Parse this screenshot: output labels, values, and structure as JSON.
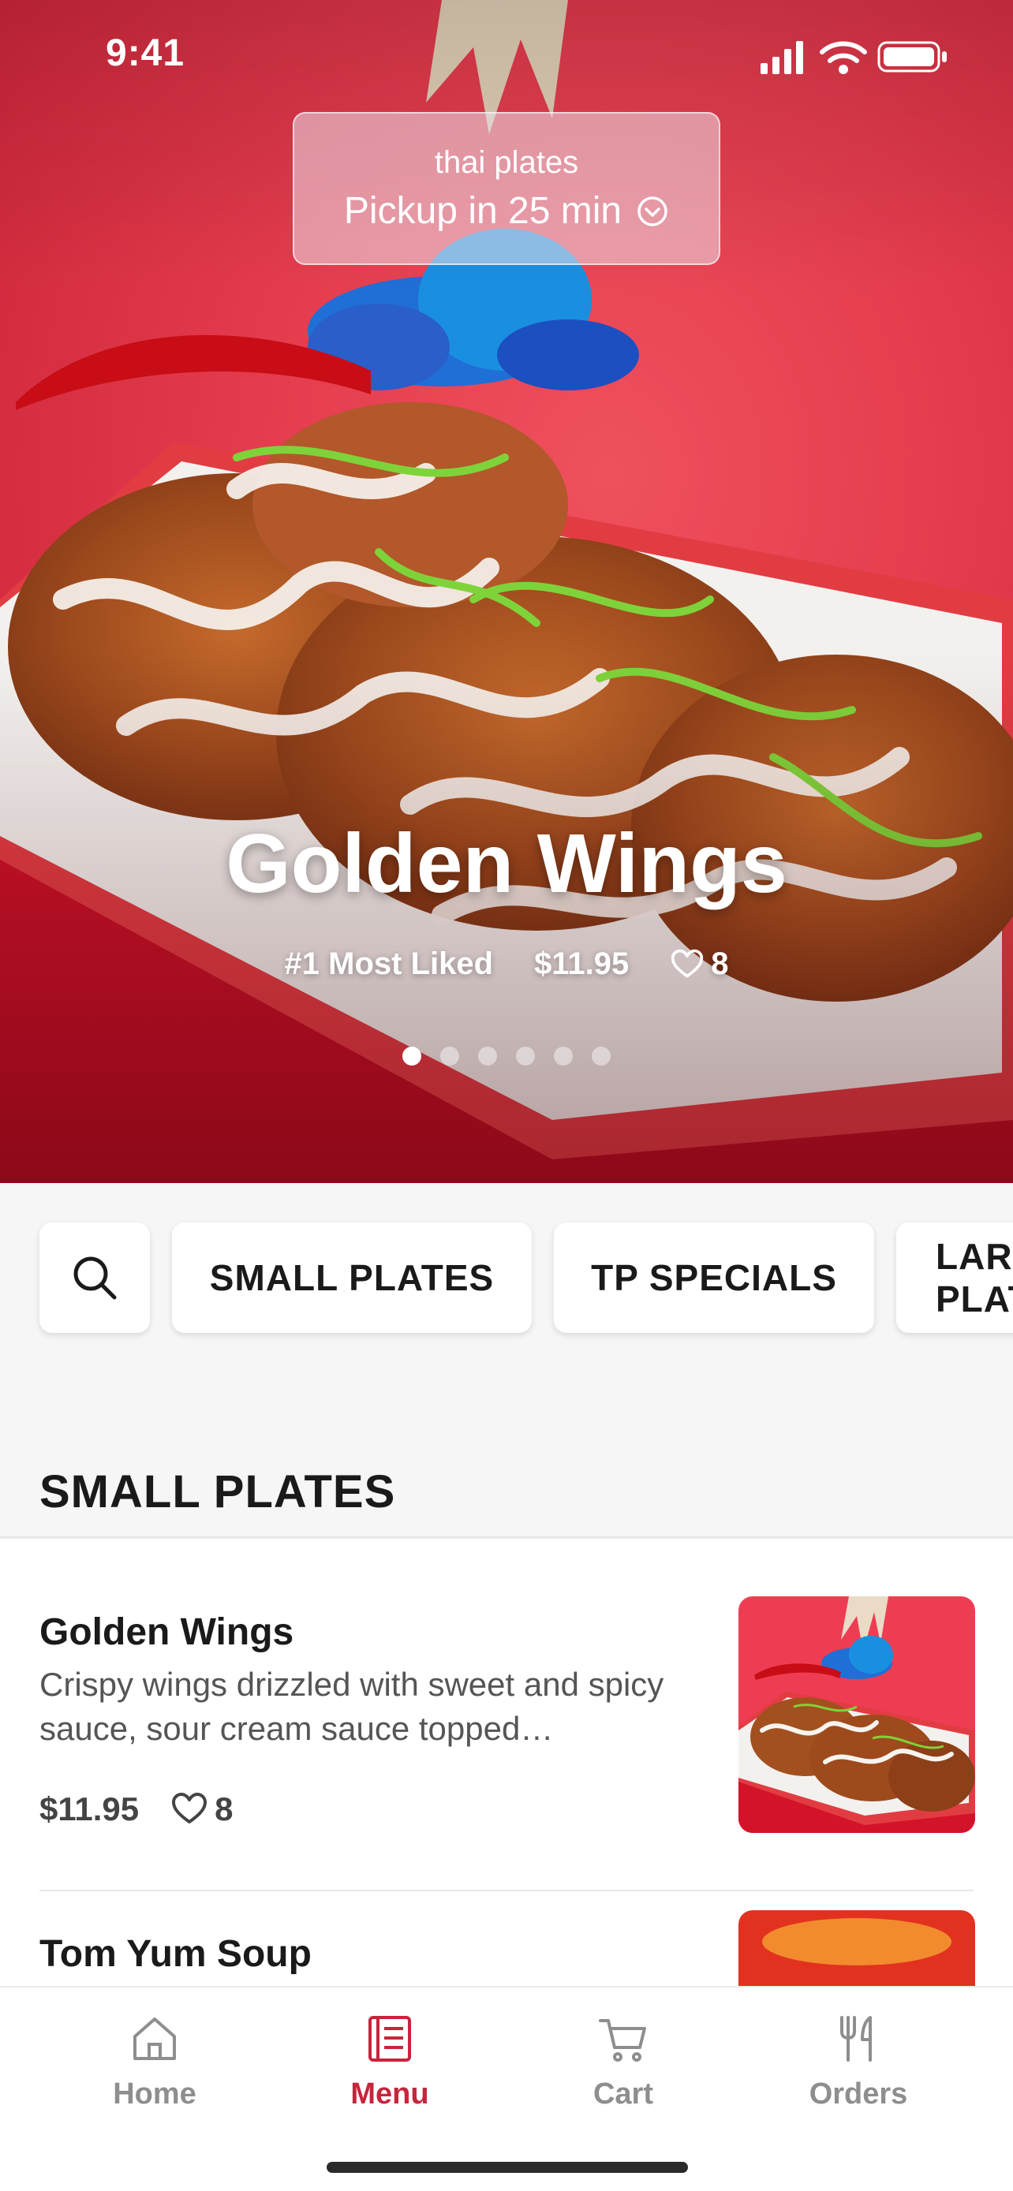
{
  "status_bar": {
    "time": "9:41"
  },
  "pickup": {
    "restaurant": "thai plates",
    "eta_label": "Pickup in 25 min",
    "chevron_icon": "chevron-down-circle-icon"
  },
  "hero": {
    "title": "Golden Wings",
    "badge": "#1 Most Liked",
    "price": "$11.95",
    "likes": "8",
    "slide_count": 6,
    "active_slide": 0
  },
  "categories": {
    "search_icon": "search-icon",
    "items": [
      "SMALL PLATES",
      "TP SPECIALS",
      "LARGE PLATES"
    ]
  },
  "section": {
    "title": "SMALL PLATES"
  },
  "menu_items": [
    {
      "name": "Golden Wings",
      "description": "Crispy wings drizzled with sweet and spicy sauce, sour cream sauce topped…",
      "price": "$11.95",
      "likes": "8"
    },
    {
      "name": "Tom Yum Soup"
    }
  ],
  "tab_bar": {
    "tabs": [
      {
        "label": "Home",
        "icon": "home-icon",
        "active": false
      },
      {
        "label": "Menu",
        "icon": "menu-book-icon",
        "active": true
      },
      {
        "label": "Cart",
        "icon": "cart-icon",
        "active": false
      },
      {
        "label": "Orders",
        "icon": "utensils-icon",
        "active": false
      }
    ]
  },
  "colors": {
    "accent": "#c8243c",
    "hero_bg": "#e23a4c",
    "muted": "#8e8e8e"
  }
}
